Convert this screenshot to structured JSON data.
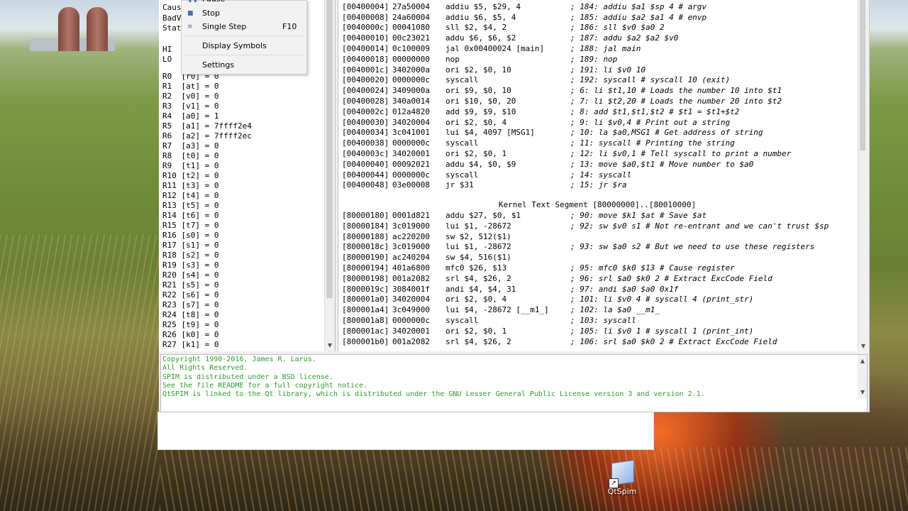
{
  "desktop": {
    "icon_label": "QtSpim"
  },
  "menu": {
    "items": [
      {
        "icon": "pause-icon",
        "label": "Pause",
        "shortcut": ""
      },
      {
        "icon": "stop-icon",
        "label": "Stop",
        "shortcut": ""
      },
      {
        "icon": "single-step-icon",
        "label": "Single Step",
        "shortcut": "F10"
      },
      {
        "icon": "",
        "label": "Display Symbols",
        "shortcut": ""
      },
      {
        "icon": "",
        "label": "Settings",
        "shortcut": ""
      }
    ]
  },
  "registers": {
    "top_labels": [
      "Caus",
      "BadV",
      "Stat",
      "HI",
      "LO"
    ],
    "list": [
      "R0  [r0] = 0",
      "R1  [at] = 0",
      "R2  [v0] = 0",
      "R3  [v1] = 0",
      "R4  [a0] = 1",
      "R5  [a1] = 7ffff2e4",
      "R6  [a2] = 7ffff2ec",
      "R7  [a3] = 0",
      "R8  [t0] = 0",
      "R9  [t1] = 0",
      "R10 [t2] = 0",
      "R11 [t3] = 0",
      "R12 [t4] = 0",
      "R13 [t5] = 0",
      "R14 [t6] = 0",
      "R15 [t7] = 0",
      "R16 [s0] = 0",
      "R17 [s1] = 0",
      "R18 [s2] = 0",
      "R19 [s3] = 0",
      "R20 [s4] = 0",
      "R21 [s5] = 0",
      "R22 [s6] = 0",
      "R23 [s7] = 0",
      "R24 [t8] = 0",
      "R25 [t9] = 0",
      "R26 [k0] = 0",
      "R27 [k1] = 0"
    ]
  },
  "text_segment": {
    "user_rows": [
      {
        "addr": "[00400000]",
        "hex": "8fa40000",
        "instr": "lw $4, 0($29)",
        "cmt": "; 183: lw $a0 0($sp) # argc"
      },
      {
        "addr": "[00400004]",
        "hex": "27a50004",
        "instr": "addiu $5, $29, 4",
        "cmt": "; 184: addiu $a1 $sp 4 # argv"
      },
      {
        "addr": "[00400008]",
        "hex": "24a60004",
        "instr": "addiu $6, $5, 4",
        "cmt": "; 185: addiu $a2 $a1 4 # envp"
      },
      {
        "addr": "[0040000c]",
        "hex": "00041080",
        "instr": "sll $2, $4, 2",
        "cmt": "; 186: sll $v0 $a0 2"
      },
      {
        "addr": "[00400010]",
        "hex": "00c23021",
        "instr": "addu $6, $6, $2",
        "cmt": "; 187: addu $a2 $a2 $v0"
      },
      {
        "addr": "[00400014]",
        "hex": "0c100009",
        "instr": "jal 0x00400024 [main]",
        "cmt": "; 188: jal main"
      },
      {
        "addr": "[00400018]",
        "hex": "00000000",
        "instr": "nop",
        "cmt": "; 189: nop"
      },
      {
        "addr": "[0040001c]",
        "hex": "3402000a",
        "instr": "ori $2, $0, 10",
        "cmt": "; 191: li $v0 10"
      },
      {
        "addr": "[00400020]",
        "hex": "0000000c",
        "instr": "syscall",
        "cmt": "; 192: syscall # syscall 10 (exit)"
      },
      {
        "addr": "[00400024]",
        "hex": "3409000a",
        "instr": "ori $9, $0, 10",
        "cmt": "; 6: li $t1,10 # Loads the number 10 into $t1"
      },
      {
        "addr": "[00400028]",
        "hex": "340a0014",
        "instr": "ori $10, $0, 20",
        "cmt": "; 7: li $t2,20 # Loads the number 20 into $t2"
      },
      {
        "addr": "[0040002c]",
        "hex": "012a4820",
        "instr": "add $9, $9, $10",
        "cmt": "; 8: add $t1,$t1,$t2 # $t1 = $t1+$t2"
      },
      {
        "addr": "[00400030]",
        "hex": "34020004",
        "instr": "ori $2, $0, 4",
        "cmt": "; 9: li $v0,4 # Print out a string"
      },
      {
        "addr": "[00400034]",
        "hex": "3c041001",
        "instr": "lui $4, 4097 [MSG1]",
        "cmt": "; 10: la $a0,MSG1 # Get address of string"
      },
      {
        "addr": "[00400038]",
        "hex": "0000000c",
        "instr": "syscall",
        "cmt": "; 11: syscall # Printing the string"
      },
      {
        "addr": "[0040003c]",
        "hex": "34020001",
        "instr": "ori $2, $0, 1",
        "cmt": "; 12: li $v0,1 # Tell syscall to print a number"
      },
      {
        "addr": "[00400040]",
        "hex": "00092021",
        "instr": "addu $4, $0, $9",
        "cmt": "; 13: move $a0,$t1 # Move number to $a0"
      },
      {
        "addr": "[00400044]",
        "hex": "0000000c",
        "instr": "syscall",
        "cmt": "; 14: syscall"
      },
      {
        "addr": "[00400048]",
        "hex": "03e00008",
        "instr": "jr $31",
        "cmt": "; 15: jr $ra"
      }
    ],
    "kernel_header": "Kernel Text Segment [80000000]..[80010000]",
    "kernel_rows": [
      {
        "addr": "[80000180]",
        "hex": "0001d821",
        "instr": "addu $27, $0, $1",
        "cmt": "; 90: move $k1 $at # Save $at"
      },
      {
        "addr": "[80000184]",
        "hex": "3c019000",
        "instr": "lui $1, -28672",
        "cmt": "; 92: sw $v0 s1 # Not re-entrant and we can't trust $sp"
      },
      {
        "addr": "[80000188]",
        "hex": "ac220200",
        "instr": "sw $2, 512($1)",
        "cmt": ""
      },
      {
        "addr": "[8000018c]",
        "hex": "3c019000",
        "instr": "lui $1, -28672",
        "cmt": "; 93: sw $a0 s2 # But we need to use these registers"
      },
      {
        "addr": "[80000190]",
        "hex": "ac240204",
        "instr": "sw $4, 516($1)",
        "cmt": ""
      },
      {
        "addr": "[80000194]",
        "hex": "401a6800",
        "instr": "mfc0 $26, $13",
        "cmt": "; 95: mfc0 $k0 $13 # Cause register"
      },
      {
        "addr": "[80000198]",
        "hex": "001a2082",
        "instr": "srl $4, $26, 2",
        "cmt": "; 96: srl $a0 $k0 2 # Extract ExcCode Field"
      },
      {
        "addr": "[8000019c]",
        "hex": "3084001f",
        "instr": "andi $4, $4, 31",
        "cmt": "; 97: andi $a0 $a0 0x1f"
      },
      {
        "addr": "[800001a0]",
        "hex": "34020004",
        "instr": "ori $2, $0, 4",
        "cmt": "; 101: li $v0 4 # syscall 4 (print_str)"
      },
      {
        "addr": "[800001a4]",
        "hex": "3c049000",
        "instr": "lui $4, -28672 [__m1_]",
        "cmt": "; 102: la $a0 __m1_"
      },
      {
        "addr": "[800001a8]",
        "hex": "0000000c",
        "instr": "syscall",
        "cmt": "; 103: syscall"
      },
      {
        "addr": "[800001ac]",
        "hex": "34020001",
        "instr": "ori $2, $0, 1",
        "cmt": "; 105: li $v0 1 # syscall 1 (print_int)"
      },
      {
        "addr": "[800001b0]",
        "hex": "001a2082",
        "instr": "srl $4, $26, 2",
        "cmt": "; 106: srl $a0 $k0 2 # Extract ExcCode Field"
      }
    ]
  },
  "console": {
    "lines": [
      "Copyright 1990-2016, James R. Larus.",
      "All Rights Reserved.",
      "SPIM is distributed under a BSD license.",
      "See the file README for a full copyright notice.",
      "QtSPIM is linked to the Qt library, which is distributed under the GNU Lesser General Public License version 3 and version 2.1."
    ],
    "color": "#2e9c2e"
  }
}
